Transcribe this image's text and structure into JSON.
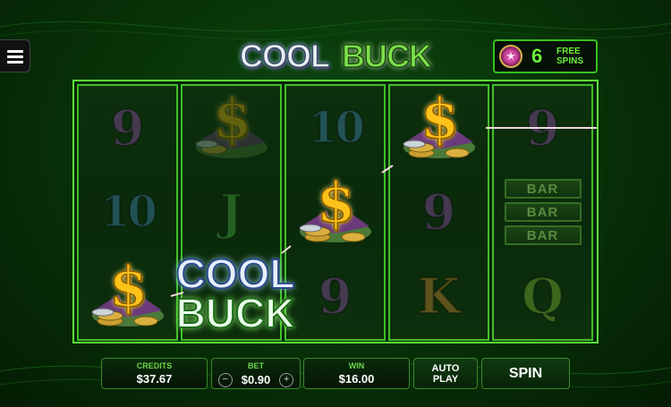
{
  "logo": {
    "word1": "COOL",
    "word2": "BUCK"
  },
  "free_spins": {
    "count": "6",
    "label_line1": "FREE",
    "label_line2": "SPINS",
    "icon": "star-badge-icon"
  },
  "reels": [
    [
      "9",
      "10",
      "CASH"
    ],
    [
      "CASH",
      "J",
      "WILD"
    ],
    [
      "10",
      "CASH",
      "9"
    ],
    [
      "CASH",
      "9",
      "K"
    ],
    [
      "9",
      "BAR",
      "Q"
    ]
  ],
  "symbols": {
    "bar": "BAR",
    "dollar": "$",
    "wild_line1": "COOL",
    "wild_line2": "BUCK"
  },
  "credits": {
    "label": "CREDITS",
    "value": "$37.67"
  },
  "bet": {
    "label": "BET",
    "value": "$0.90",
    "minus": "−",
    "plus": "+"
  },
  "win": {
    "label": "WIN",
    "value": "$16.00"
  },
  "buttons": {
    "autoplay_line1": "AUTO",
    "autoplay_line2": "PLAY",
    "spin": "SPIN"
  },
  "colors": {
    "accent": "#5be33a",
    "gold": "#ffc21a",
    "background": "#083508"
  }
}
